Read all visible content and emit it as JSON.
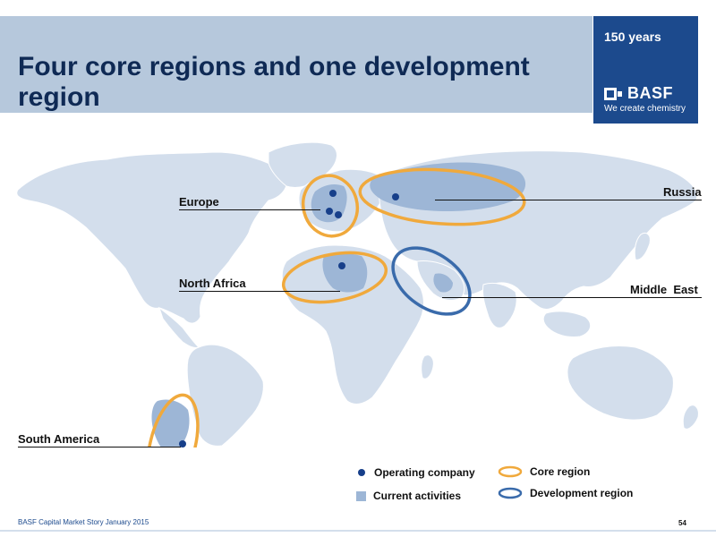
{
  "slide": {
    "title": "Four core regions and one development region",
    "footer_source": "BASF Capital Market Story January 2015",
    "page_number": "54"
  },
  "brand": {
    "anniversary": "150 years",
    "logo_text": "BASF",
    "tagline": "We create chemistry",
    "color": "#1c4a8d"
  },
  "map": {
    "land_color": "#d3deec",
    "active_color": "#9db6d6",
    "core_ring_color": "#f0a93c",
    "development_ring_color": "#3a6bab",
    "dot_color": "#173f8a",
    "regions": {
      "europe": "Europe",
      "russia": "Russia",
      "north_africa": "North Africa",
      "middle_east": "Middle  East",
      "south_america": "South America"
    }
  },
  "legend": {
    "operating_company": "Operating company",
    "current_activities": "Current activities",
    "core_region": "Core region",
    "development_region": "Development region"
  }
}
